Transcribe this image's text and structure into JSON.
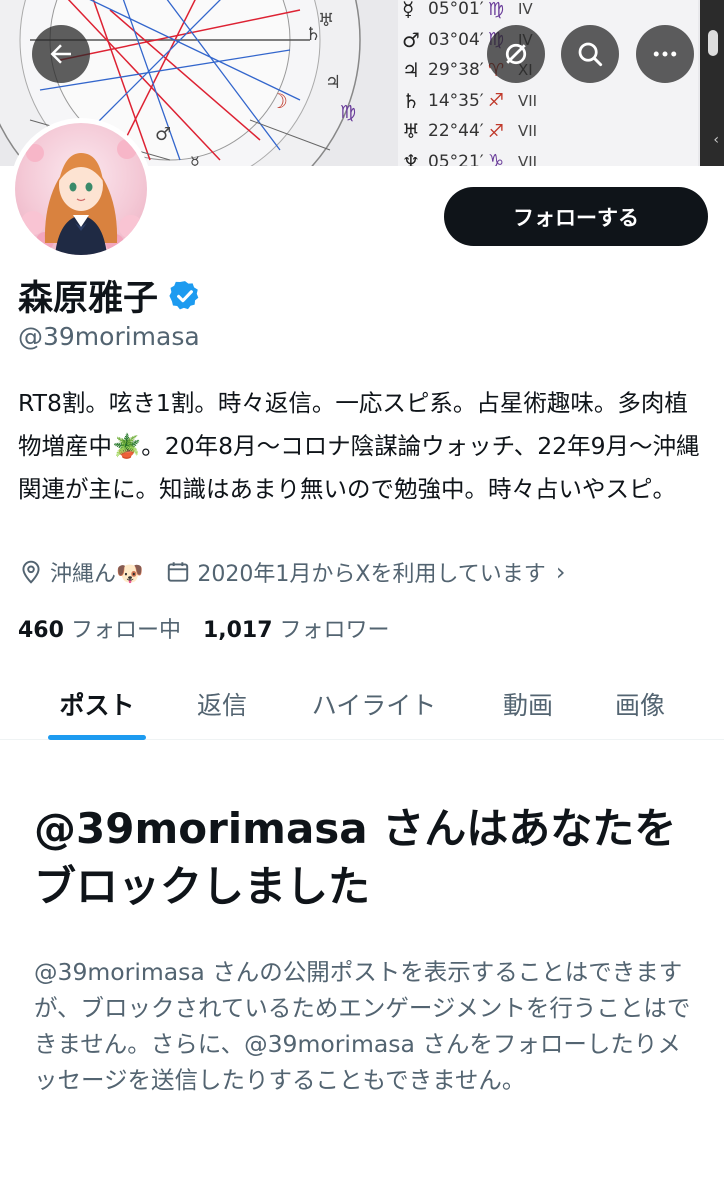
{
  "banner": {
    "planets": [
      {
        "symbol": "☿",
        "degree": "05°01′",
        "sign": "♍",
        "sign_color": "purple",
        "house": "IV"
      },
      {
        "symbol": "♂",
        "degree": "03°04′",
        "sign": "♍",
        "sign_color": "purple",
        "house": "IV"
      },
      {
        "symbol": "♃",
        "degree": "29°38′",
        "sign": "♈",
        "sign_color": "red",
        "house": "XI"
      },
      {
        "symbol": "♄",
        "degree": "14°35′",
        "sign": "♐",
        "sign_color": "red",
        "house": "VII"
      },
      {
        "symbol": "♅",
        "degree": "22°44′",
        "sign": "♐",
        "sign_color": "red",
        "house": "VII"
      },
      {
        "symbol": "♆",
        "degree": "05°21′",
        "sign": "♑",
        "sign_color": "purple",
        "house": "VII"
      }
    ]
  },
  "nav": {
    "back_icon": "arrow-left-icon",
    "refresh_icon": "refresh-icon",
    "search_icon": "search-icon",
    "more_icon": "more-icon"
  },
  "profile": {
    "display_name": "森原雅子",
    "handle": "@39morimasa",
    "follow_button": "フォローする",
    "bio": "RT8割。呟き1割。時々返信。一応スピ系。占星術趣味。多肉植物増産中🪴。20年8月〜コロナ陰謀論ウォッチ、22年9月〜沖縄関連が主に。知識はあまり無いので勉強中。時々占いやスピ。",
    "location": "沖縄ん🐶",
    "joined": "2020年1月からXを利用しています",
    "following_count": "460",
    "following_label": "フォロー中",
    "followers_count": "1,017",
    "followers_label": "フォロワー"
  },
  "tabs": [
    {
      "label": "ポスト",
      "active": true
    },
    {
      "label": "返信",
      "active": false
    },
    {
      "label": "ハイライト",
      "active": false
    },
    {
      "label": "動画",
      "active": false
    },
    {
      "label": "画像",
      "active": false
    }
  ],
  "blocked": {
    "title": "@39morimasa さんはあなたをブロックしました",
    "description": "@39morimasa さんの公開ポストを表示することはできますが、ブロックされているためエンゲージメントを行うことはできません。さらに、@39morimasa さんをフォローしたりメッセージを送信したりすることもできません。"
  },
  "colors": {
    "accent": "#1d9bf0",
    "text_primary": "#0f1419",
    "text_secondary": "#536471",
    "button_bg": "#0f1419"
  }
}
